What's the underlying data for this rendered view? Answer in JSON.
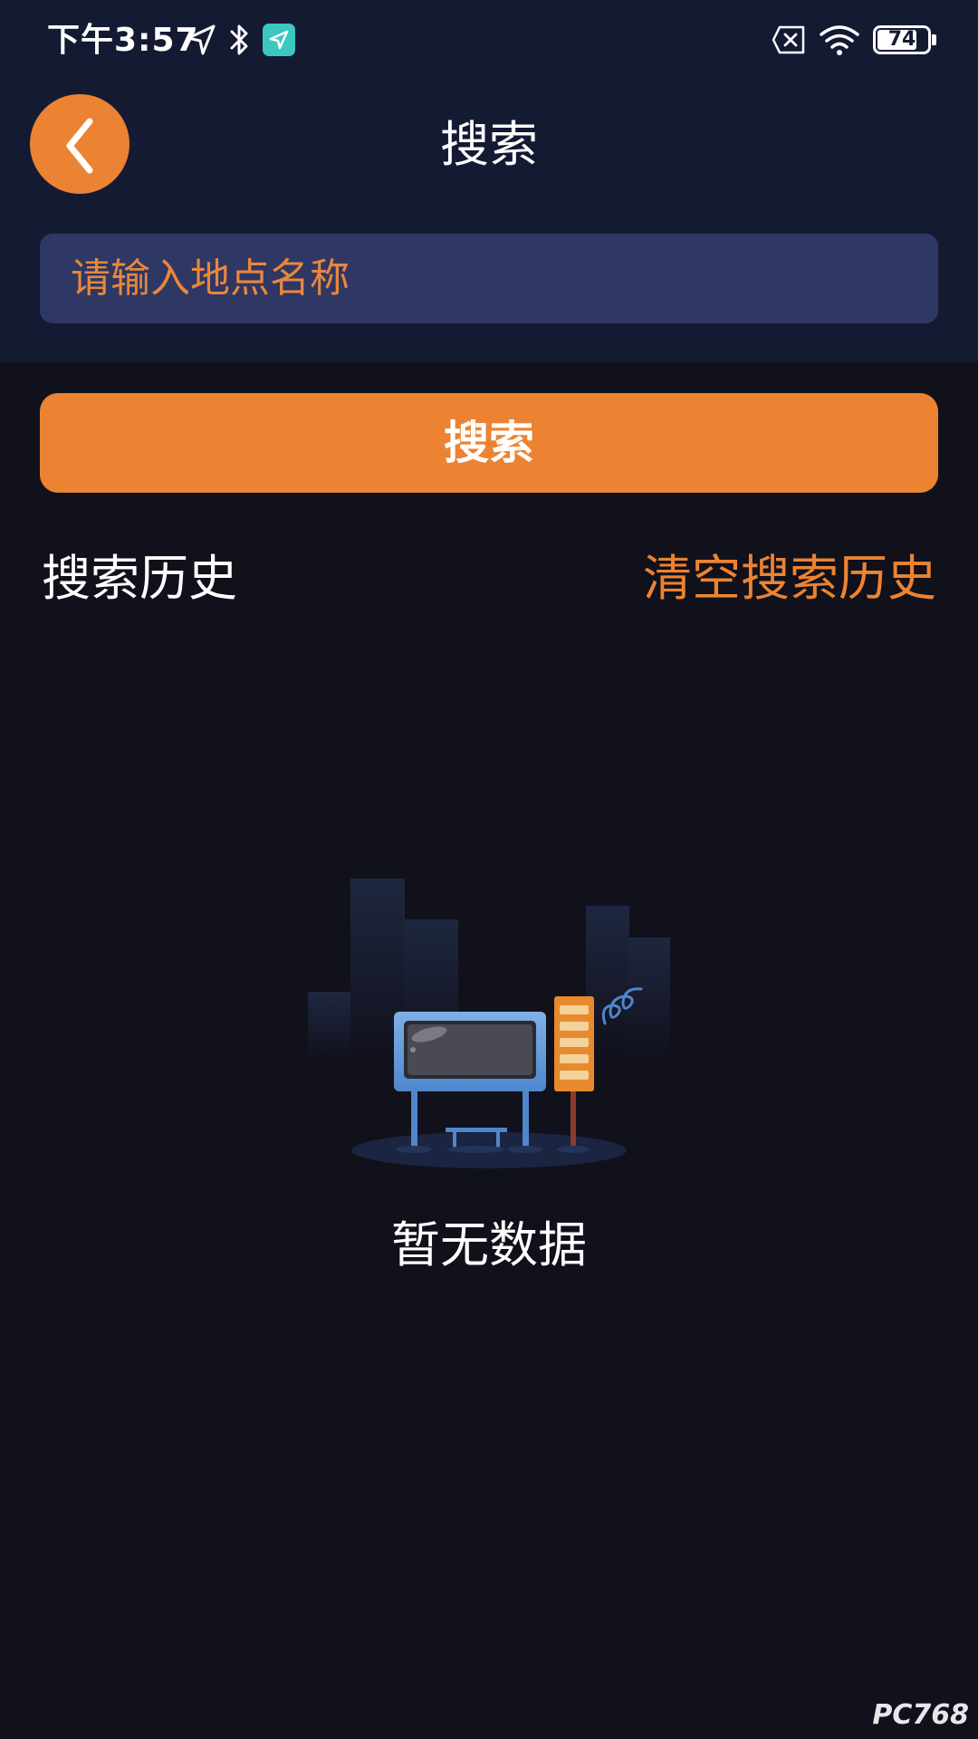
{
  "status_bar": {
    "time": "下午3:57",
    "battery_level": "74",
    "icons": [
      "location-arrow-icon",
      "bluetooth-icon",
      "app-notification-icon",
      "sim-no-signal-icon",
      "wifi-icon",
      "battery-icon"
    ]
  },
  "header": {
    "back_icon": "chevron-left-icon",
    "title": "搜索"
  },
  "search": {
    "placeholder": "请输入地点名称",
    "value": "",
    "button_label": "搜索"
  },
  "history": {
    "title": "搜索历史",
    "clear_label": "清空搜索历史"
  },
  "empty_state": {
    "illustration": "bus-stop-illustration",
    "text": "暂无数据"
  },
  "watermark": "PC768",
  "colors": {
    "accent": "#ec8332",
    "header_bg": "#151a33",
    "page_bg": "#11111c",
    "input_bg": "#2f3764"
  }
}
